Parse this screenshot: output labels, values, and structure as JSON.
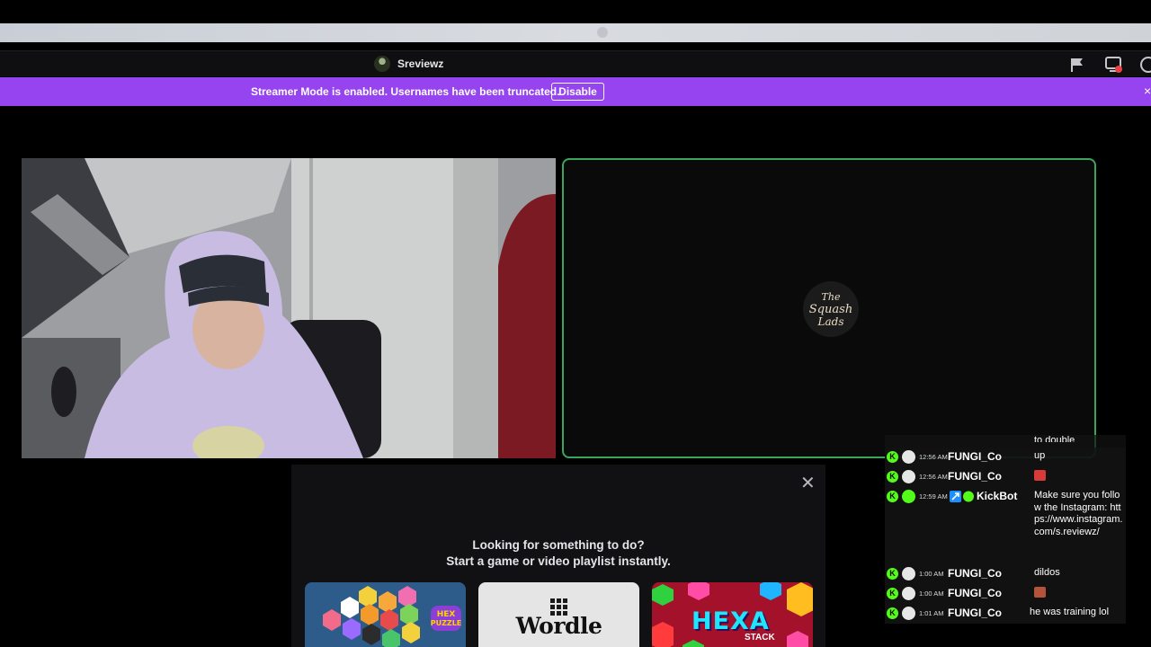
{
  "title_bar": {
    "server_name": "Sreviewz",
    "icons": [
      "server-avatar-icon",
      "flag-icon",
      "screen-share-icon",
      "help-icon"
    ]
  },
  "banner": {
    "text": "Streamer Mode is enabled. Usernames have been truncated.",
    "disable_label": "Disable",
    "close_glyph": "×",
    "color": "#9643f0"
  },
  "video": {
    "screen_tile_border": "#3ba55d",
    "screen_logo_text": "The Squash Lads"
  },
  "activity": {
    "close_glyph": "✕",
    "line1": "Looking for something to do?",
    "line2": "Start a game or video playlist instantly.",
    "cards": {
      "hex_puzzle": "HEX PUZZLE",
      "wordle": "Wordle",
      "hexa_stack_title": "HEXA",
      "hexa_stack_sub": "STACK"
    }
  },
  "chat": {
    "partial_top": "to double",
    "messages": [
      {
        "time": "12:56 AM",
        "user": "FUNGI_Co",
        "text": "up"
      },
      {
        "time": "12:56 AM",
        "user": "FUNGI_Co",
        "text": "",
        "emote": "#d83a3a"
      },
      {
        "time": "12:59 AM",
        "user": "KickBot",
        "text": "Make sure you follow the Instagram: https://www.instagram.com/s.reviewz/"
      },
      {
        "time": "1:00 AM",
        "user": "FUNGI_Co",
        "text": "dildos"
      },
      {
        "time": "1:00 AM",
        "user": "FUNGI_Co",
        "text": "",
        "emote": "#b5523a"
      },
      {
        "time": "1:01 AM",
        "user": "FUNGI_Co",
        "text": "he was training lol"
      }
    ],
    "kick_badge": "K",
    "kick_color": "#53fc18"
  }
}
